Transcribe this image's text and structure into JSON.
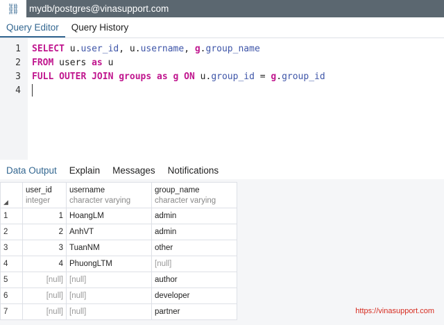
{
  "title": "mydb/postgres@vinasupport.com",
  "editor_tabs": [
    "Query Editor",
    "Query History"
  ],
  "line_numbers": [
    "1",
    "2",
    "3",
    "4"
  ],
  "code": {
    "l1": [
      "SELECT",
      " u.",
      "user_id",
      ", u.",
      "username",
      ", ",
      "g",
      ".",
      "group_name"
    ],
    "l2": [
      "FROM",
      " users ",
      "as",
      " u"
    ],
    "l3": [
      "FULL OUTER JOIN",
      " groups ",
      "as",
      " g ",
      "ON",
      " u.",
      "group_id",
      " = ",
      "g",
      ".",
      "group_id"
    ]
  },
  "result_tabs": [
    "Data Output",
    "Explain",
    "Messages",
    "Notifications"
  ],
  "columns": [
    {
      "name": "user_id",
      "type": "integer"
    },
    {
      "name": "username",
      "type": "character varying"
    },
    {
      "name": "group_name",
      "type": "character varying"
    }
  ],
  "rows": [
    [
      "1",
      "1",
      "HoangLM",
      "admin"
    ],
    [
      "2",
      "2",
      "AnhVT",
      "admin"
    ],
    [
      "3",
      "3",
      "TuanNM",
      "other"
    ],
    [
      "4",
      "4",
      "PhuongLTM",
      "[null]"
    ],
    [
      "5",
      "[null]",
      "[null]",
      "author"
    ],
    [
      "6",
      "[null]",
      "[null]",
      "developer"
    ],
    [
      "7",
      "[null]",
      "[null]",
      "partner"
    ]
  ],
  "watermark": "https://vinasupport.com"
}
